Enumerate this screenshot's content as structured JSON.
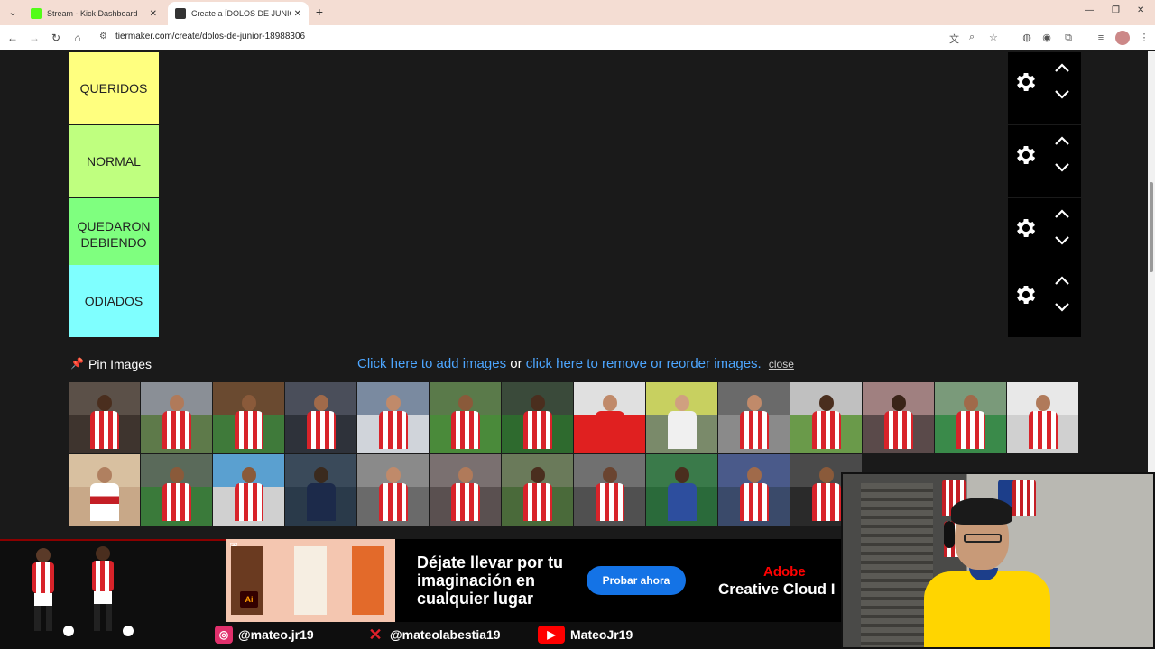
{
  "browser": {
    "tabs": [
      {
        "title": "Stream - Kick Dashboard",
        "favicon_color": "#53fc18",
        "active": false
      },
      {
        "title": "Create a ÍDOLOS DE JUNIOR Ti",
        "favicon_color": "#333333",
        "active": true
      }
    ],
    "url": "tiermaker.com/create/dolos-de-junior-18988306"
  },
  "tiers": [
    {
      "label": "QUERIDOS",
      "color": "#ffff7f"
    },
    {
      "label": "NORMAL",
      "color": "#bfff7f"
    },
    {
      "label": "QUEDARON DEBIENDO",
      "color": "#7fff7f"
    },
    {
      "label": "ODIADOS",
      "color": "#7fffff"
    }
  ],
  "pin_images": {
    "label": "Pin Images",
    "link_add": "Click here to add images",
    "or_text": " or ",
    "link_remove": "click here to remove or reorder images.",
    "close": "close"
  },
  "ad": {
    "headline": "Déjate llevar por tu imaginación en cualquier lugar",
    "cta": "Probar ahora",
    "brand_line1": "Adobe",
    "brand_line2": "Creative Cloud I",
    "badge": "Ai"
  },
  "socials": [
    {
      "icon": "instagram-icon",
      "handle": "@mateo.jr19",
      "color": "#e1306c"
    },
    {
      "icon": "x-icon",
      "handle": "@mateolabestia19",
      "color": "#e0202a"
    },
    {
      "icon": "youtube-icon",
      "handle": "MateoJr19",
      "color": "#ff0000"
    }
  ]
}
